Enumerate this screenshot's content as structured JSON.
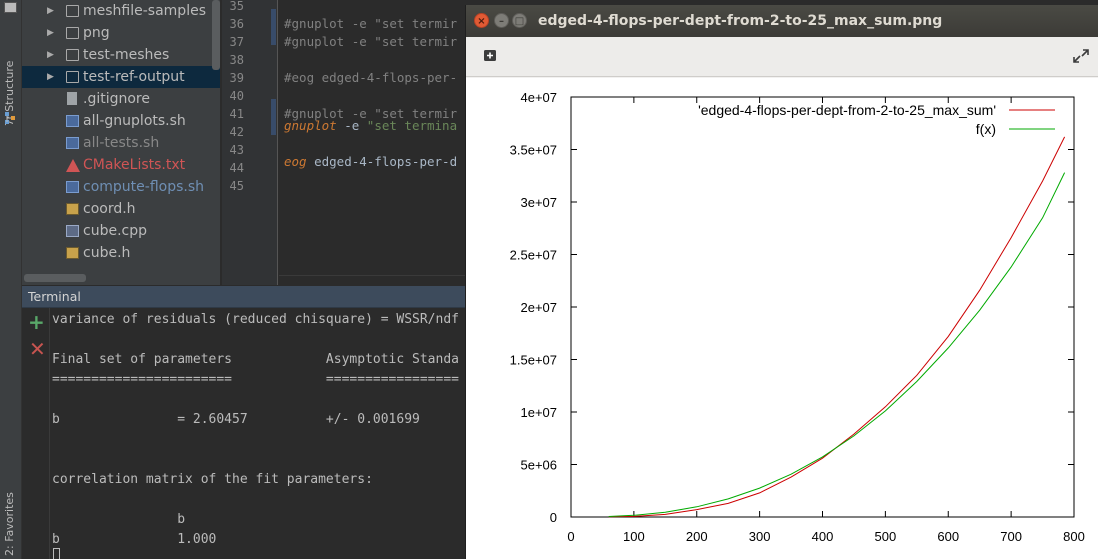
{
  "left_stripe": {
    "structure_label": "7: Structure",
    "favorites_label": "2: Favorites"
  },
  "project_tree": {
    "items": [
      {
        "label": "meshfile-samples",
        "type": "folder",
        "expandable": true,
        "color": "#bbbbbb"
      },
      {
        "label": "png",
        "type": "folder",
        "expandable": true,
        "color": "#bbbbbb"
      },
      {
        "label": "test-meshes",
        "type": "folder",
        "expandable": true,
        "color": "#bbbbbb"
      },
      {
        "label": "test-ref-output",
        "type": "folder",
        "expandable": true,
        "color": "#bbbbbb",
        "selected": true
      },
      {
        "label": ".gitignore",
        "type": "file",
        "color": "#bbbbbb"
      },
      {
        "label": "all-gnuplots.sh",
        "type": "sh",
        "color": "#bbbbbb"
      },
      {
        "label": "all-tests.sh",
        "type": "sh",
        "color": "#888888"
      },
      {
        "label": "CMakeLists.txt",
        "type": "cmake",
        "color": "#d05555"
      },
      {
        "label": "compute-flops.sh",
        "type": "sh",
        "color": "#6f8fb4"
      },
      {
        "label": "coord.h",
        "type": "h",
        "color": "#bbbbbb"
      },
      {
        "label": "cube.cpp",
        "type": "cpp",
        "color": "#bbbbbb"
      },
      {
        "label": "cube.h",
        "type": "h",
        "color": "#bbbbbb"
      }
    ]
  },
  "editor": {
    "line_numbers": [
      "35",
      "36",
      "37",
      "38",
      "39",
      "40",
      "41",
      "42",
      "43",
      "44",
      "45"
    ],
    "lines": [
      "",
      "#gnuplot -e \"set termir",
      "#gnuplot -e \"set termir",
      "",
      "#eog edged-4-flops-per-",
      "",
      "#gnuplot -e \"set termir",
      "",
      "",
      "",
      ""
    ],
    "line42": {
      "cmd": "gnuplot",
      "arg": " -e ",
      "str": "\"set termina"
    },
    "line44": {
      "cmd": "eog",
      "rest": " edged-4-flops-per-d"
    }
  },
  "terminal": {
    "title": "Terminal",
    "add_icon": "plus-icon",
    "close_icon": "close-icon",
    "lines": [
      "variance of residuals (reduced chisquare) = WSSR/ndf",
      "",
      "Final set of parameters            Asymptotic Standa",
      "=======================            =================",
      "",
      "b               = 2.60457          +/- 0.001699",
      "",
      "",
      "correlation matrix of the fit parameters:",
      "",
      "                b",
      "b               1.000"
    ]
  },
  "viewer": {
    "title": "edged-4-flops-per-dept-from-2-to-25_max_sum.png",
    "gallery_icon": "gallery-icon",
    "fullscreen_icon": "fullscreen-icon"
  },
  "chart_data": {
    "type": "line",
    "title": "",
    "xlabel": "",
    "ylabel": "",
    "xlim": [
      0,
      800
    ],
    "ylim": [
      0,
      40000000
    ],
    "x_ticks": [
      "0",
      "100",
      "200",
      "300",
      "400",
      "500",
      "600",
      "700",
      "800"
    ],
    "y_ticks": [
      "0",
      "5e+06",
      "1e+07",
      "1.5e+07",
      "2e+07",
      "2.5e+07",
      "3e+07",
      "3.5e+07",
      "4e+07"
    ],
    "legend_position": "top-right",
    "grid": false,
    "series": [
      {
        "name": "'edged-4-flops-per-dept-from-2-to-25_max_sum'",
        "color": "#cc0000",
        "x": [
          60,
          100,
          150,
          200,
          250,
          300,
          350,
          400,
          450,
          500,
          550,
          600,
          650,
          700,
          750,
          785
        ],
        "y": [
          20000,
          60000,
          250000,
          700000,
          1300000,
          2300000,
          3800000,
          5600000,
          7900000,
          10500000,
          13500000,
          17200000,
          21600000,
          26600000,
          32000000,
          36200000
        ]
      },
      {
        "name": "f(x)",
        "color": "#00aa00",
        "x": [
          60,
          100,
          150,
          200,
          250,
          300,
          350,
          400,
          450,
          500,
          550,
          600,
          650,
          700,
          750,
          785
        ],
        "y": [
          45000,
          160000,
          460000,
          970000,
          1720000,
          2750000,
          4080000,
          5720000,
          7720000,
          10100000,
          12900000,
          16100000,
          19700000,
          23800000,
          28500000,
          32800000
        ]
      }
    ]
  }
}
